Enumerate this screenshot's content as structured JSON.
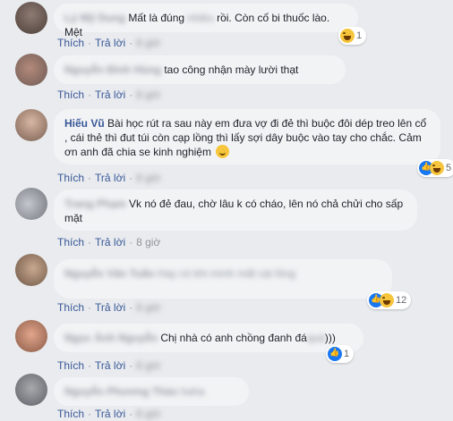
{
  "actions": {
    "like": "Thích",
    "reply": "Trả lời",
    "separator": "·"
  },
  "comments": [
    {
      "name": "Lý Mỹ Dung",
      "text_pre": "Mất là đúng ",
      "text_blur": "nhiều",
      "text_post": " rồi. Còn cố bi thuốc lào. Mệt",
      "time": "8 giờ",
      "reaction_count": "1",
      "reaction_icons": [
        "haha-icon"
      ]
    },
    {
      "name": "Nguyễn Đình Hùng",
      "text": "tao công nhận mày lười thạt",
      "time": "8 giờ"
    },
    {
      "name": "Hiếu Vũ",
      "text": "Bài học rút ra sau này em đưa vợ đi đẻ thì buộc đôi dép treo lên cổ , cái thẻ thì đut túi còn cạp lồng thì lấy sợi dây buộc vào tay cho chắc. Cảm ơn anh đã chia se kinh nghiệm",
      "time": "8 giờ",
      "reaction_count": "5",
      "reaction_icons": [
        "like-icon",
        "haha-icon"
      ]
    },
    {
      "name": "Trang Phạm",
      "text": "Vk nó đẻ đau, chờ lâu k có cháo, lên nó chả chửi cho sấp mặt",
      "time": "8 giờ"
    },
    {
      "name": "Nguyễn Văn Tuấn",
      "text_blur": "Hay có khi mình mất cái lồng",
      "time": "8 giờ",
      "reaction_count": "12",
      "reaction_icons": [
        "like-icon",
        "haha-icon"
      ]
    },
    {
      "name": "Ngọc Ánh Nguyễn",
      "text_pre": "Chị nhà có anh chồng đanh đá",
      "text_blur": "quá",
      "text_post": ")))",
      "time": "8 giờ",
      "reaction_count": "1",
      "reaction_icons": [
        "like-icon"
      ]
    },
    {
      "name": "Nguyễn Phương Thảo",
      "text_blur": "haha",
      "time": "8 giờ"
    }
  ],
  "colors": {
    "link": "#385898",
    "bubble": "#f2f3f5",
    "background": "#e9ebee"
  }
}
